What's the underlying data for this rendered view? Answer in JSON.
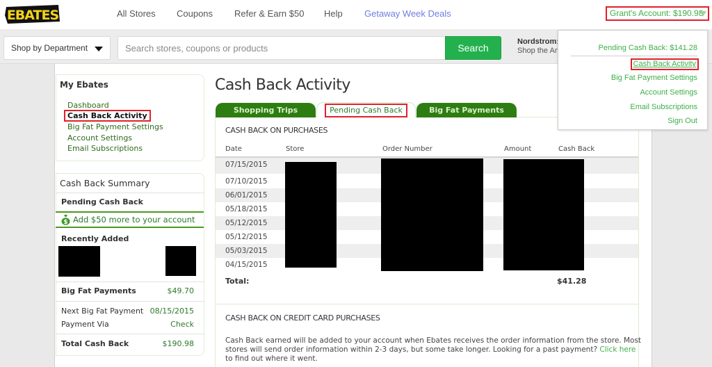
{
  "header": {
    "logo_text": "EBATES",
    "nav": [
      "All Stores",
      "Coupons",
      "Refer & Earn $50",
      "Help",
      "Getaway Week Deals"
    ],
    "account_label": "Grant's Account: $190.98"
  },
  "searchbar": {
    "department_label": "Shop by Department",
    "search_placeholder": "Search stores, coupons or products",
    "search_button": "Search",
    "promo_title": "Nordstrom:",
    "promo_subtitle": "Shop the Anniversary Sale"
  },
  "account_menu": {
    "pending": "Pending Cash Back: $141.28",
    "items": [
      "Cash Back Activity",
      "Big Fat Payment Settings",
      "Account Settings",
      "Email Subscriptions",
      "Sign Out"
    ],
    "active_item": "Cash Back Activity"
  },
  "sidebar": {
    "my_ebates_title": "My Ebates",
    "links": [
      "Dashboard",
      "Cash Back Activity",
      "Big Fat Payment Settings",
      "Account Settings",
      "Email Subscriptions"
    ],
    "active_link": "Cash Back Activity",
    "summary": {
      "title": "Cash Back Summary",
      "pending_label": "Pending Cash Back",
      "add_more": "Add $50 more to your account",
      "recently_added": "Recently Added",
      "big_fat_payments_label": "Big Fat Payments",
      "big_fat_payments_value": "$49.70",
      "next_payment_label": "Next Big Fat Payment",
      "next_payment_value": "08/15/2015",
      "payment_via_label": "Payment Via",
      "payment_via_value": "Check",
      "total_label": "Total Cash Back",
      "total_value": "$190.98"
    }
  },
  "main": {
    "title": "Cash Back Activity",
    "tabs": [
      "Shopping Trips",
      "Pending Cash Back",
      "Big Fat Payments"
    ],
    "active_tab": "Pending Cash Back",
    "purchases": {
      "section_title": "CASH BACK ON PURCHASES",
      "columns": [
        "Date",
        "Store",
        "Order Number",
        "Amount",
        "Cash Back"
      ],
      "rows": [
        {
          "date": "07/15/2015"
        },
        {
          "date": "07/10/2015"
        },
        {
          "date": "06/01/2015"
        },
        {
          "date": "05/18/2015"
        },
        {
          "date": "05/12/2015"
        },
        {
          "date": "05/12/2015"
        },
        {
          "date": "05/03/2015"
        },
        {
          "date": "04/15/2015"
        }
      ],
      "total_label": "Total:",
      "total_cash_back": "$41.28"
    },
    "credit_card": {
      "section_title": "CASH BACK ON CREDIT CARD PURCHASES",
      "note": "Cash Back earned will be added to your account when Ebates receives the order information from the store. Most stores will send order information within 2-3 days, but some take longer. Looking for a past payment? ",
      "link": "Click here",
      "note_end": " to find out where it went."
    }
  }
}
